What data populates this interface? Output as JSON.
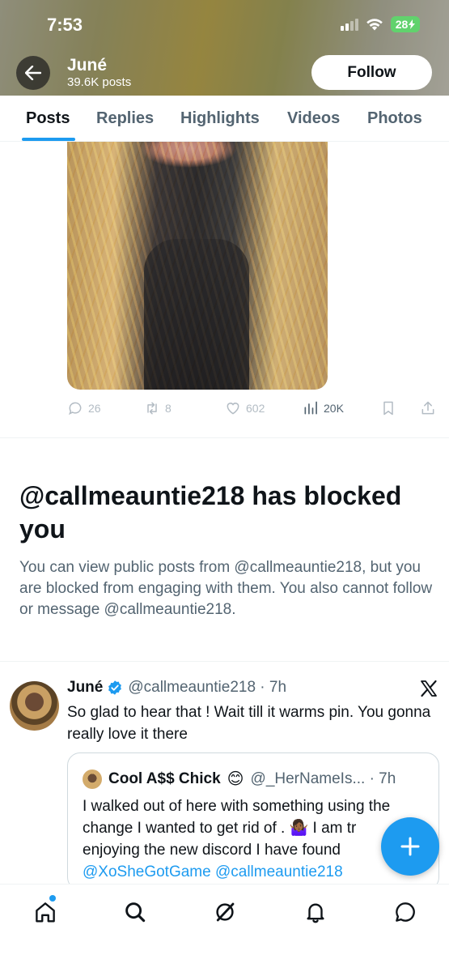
{
  "status_bar": {
    "time": "7:53",
    "battery": "28"
  },
  "header": {
    "name": "Juné",
    "posts_count": "39.6K posts",
    "follow_label": "Follow"
  },
  "tabs": [
    {
      "label": "Posts",
      "active": true
    },
    {
      "label": "Replies",
      "active": false
    },
    {
      "label": "Highlights",
      "active": false
    },
    {
      "label": "Videos",
      "active": false
    },
    {
      "label": "Photos",
      "active": false
    }
  ],
  "media_post": {
    "replies": "26",
    "reposts": "8",
    "likes": "602",
    "views": "20K"
  },
  "blocked_notice": {
    "title": "@callmeauntie218 has blocked you",
    "body": "You can view public posts from @callmeauntie218, but you are blocked from engaging with them. You also cannot follow or message @callmeauntie218."
  },
  "reply_post": {
    "name": "Juné",
    "handle": "@callmeauntie218 · 7h",
    "text": "So glad to hear that ! Wait till it warms pin. You gonna really love it there",
    "quote": {
      "name": "Cool A$$ Chick",
      "emoji": "😊",
      "handle": "@_HerNameIs... · 7h",
      "text_1": "I walked out of here with something using the change I wanted to get rid of . 🤷🏾‍♀️ I am tr",
      "text_2": "enjoying the new discord I have found",
      "mention_1": "@XoSheGotGame",
      "mention_2": "@callmeauntie218"
    }
  },
  "icons": {
    "back": "arrow-left-icon",
    "reply": "comment-icon",
    "repost": "repost-icon",
    "like": "heart-icon",
    "views": "bar-chart-icon",
    "bookmark": "bookmark-icon",
    "share": "share-icon",
    "verified": "verified-badge-icon",
    "x_logo": "x-logo-icon",
    "compose": "plus-icon",
    "nav": [
      "home-icon",
      "search-icon",
      "grok-icon",
      "notifications-icon",
      "messages-icon"
    ]
  },
  "colors": {
    "accent": "#1d9bf0",
    "text_primary": "#0f1419",
    "text_secondary": "#536471"
  }
}
